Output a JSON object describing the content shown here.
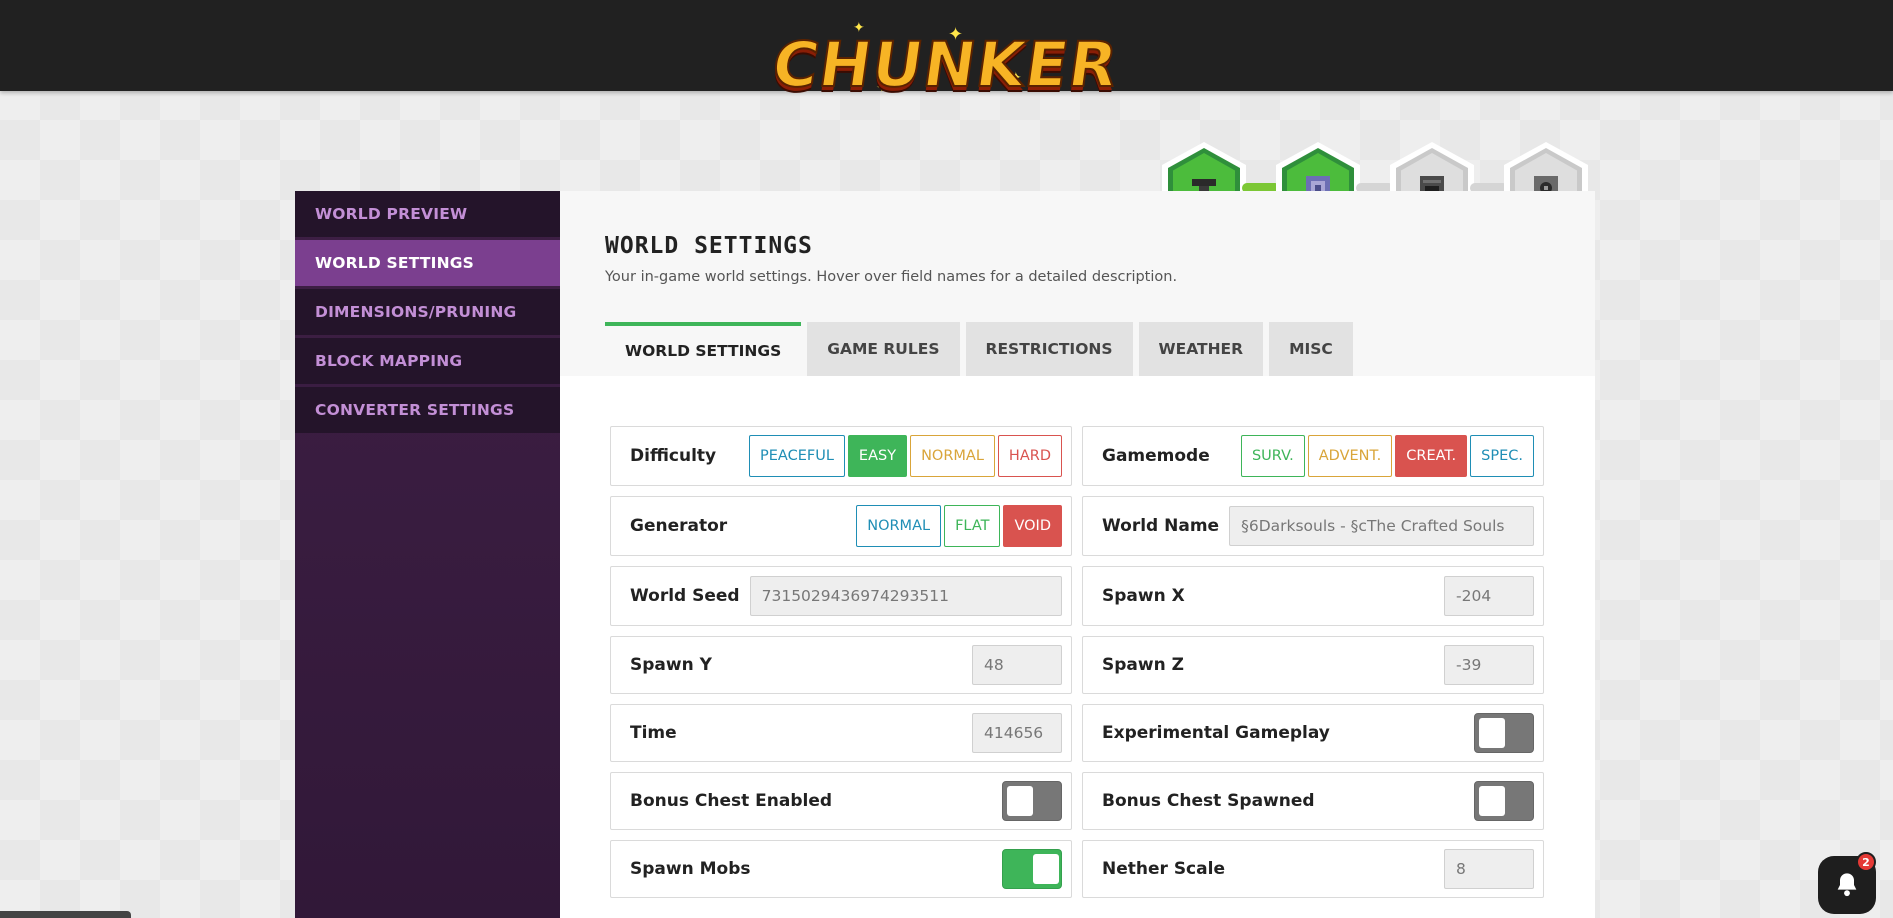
{
  "header": {
    "logo_text": "CHUNKER"
  },
  "sidebar": {
    "items": [
      {
        "label": "WORLD PREVIEW"
      },
      {
        "label": "WORLD SETTINGS"
      },
      {
        "label": "DIMENSIONS/PRUNING"
      },
      {
        "label": "BLOCK MAPPING"
      },
      {
        "label": "CONVERTER SETTINGS"
      }
    ],
    "active_index": 1
  },
  "progress": {
    "steps": [
      {
        "icon": "anvil-icon",
        "state": "complete"
      },
      {
        "icon": "command-block-icon",
        "state": "complete"
      },
      {
        "icon": "furnace-icon",
        "state": "pending"
      },
      {
        "icon": "dispenser-icon",
        "state": "pending"
      }
    ]
  },
  "page": {
    "title": "WORLD SETTINGS",
    "subtitle": "Your in-game world settings. Hover over field names for a detailed description."
  },
  "tabs": [
    {
      "label": "WORLD SETTINGS"
    },
    {
      "label": "GAME RULES"
    },
    {
      "label": "RESTRICTIONS"
    },
    {
      "label": "WEATHER"
    },
    {
      "label": "MISC"
    }
  ],
  "settings": {
    "difficulty": {
      "label": "Difficulty",
      "options": [
        "PEACEFUL",
        "EASY",
        "NORMAL",
        "HARD"
      ],
      "selected": "EASY"
    },
    "gamemode": {
      "label": "Gamemode",
      "options": [
        "SURV.",
        "ADVENT.",
        "CREAT.",
        "SPEC."
      ],
      "selected": "CREAT."
    },
    "generator": {
      "label": "Generator",
      "options": [
        "NORMAL",
        "FLAT",
        "VOID"
      ],
      "selected": "VOID"
    },
    "world_name": {
      "label": "World Name",
      "value": "§6Darksouls - §cThe Crafted Souls"
    },
    "world_seed": {
      "label": "World Seed",
      "value": "7315029436974293511"
    },
    "spawn_x": {
      "label": "Spawn X",
      "value": "-204"
    },
    "spawn_y": {
      "label": "Spawn Y",
      "value": "48"
    },
    "spawn_z": {
      "label": "Spawn Z",
      "value": "-39"
    },
    "time": {
      "label": "Time",
      "value": "414656"
    },
    "experimental_gameplay": {
      "label": "Experimental Gameplay",
      "enabled": false
    },
    "bonus_chest_enabled": {
      "label": "Bonus Chest Enabled",
      "enabled": false
    },
    "bonus_chest_spawned": {
      "label": "Bonus Chest Spawned",
      "enabled": false
    },
    "spawn_mobs": {
      "label": "Spawn Mobs",
      "enabled": true
    },
    "nether_scale": {
      "label": "Nether Scale",
      "value": "8"
    }
  },
  "chat": {
    "icon": "bell-icon",
    "badge_count": "2"
  },
  "colors": {
    "accent_green": "#3eb559",
    "accent_red": "#d9534f",
    "accent_blue": "#1f8eb5",
    "accent_yellow": "#d9a53a",
    "sidebar_active": "#7b3f8f",
    "sidebar_bg": "#24142a",
    "topbar": "#212121"
  }
}
